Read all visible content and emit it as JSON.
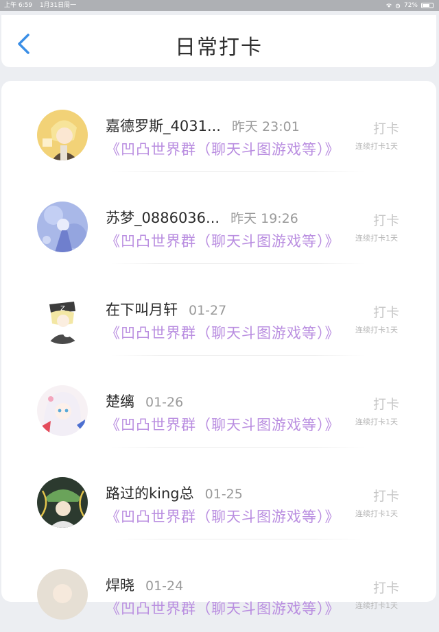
{
  "status_bar": {
    "time": "上午 6:59",
    "date": "1月31日周一",
    "battery": "72%",
    "battery_level": 0.72
  },
  "header": {
    "title": "日常打卡",
    "back_icon": "chevron-left-icon",
    "accent_color": "#3a8ee6"
  },
  "colors": {
    "group_text": "#b98de0",
    "checkin_text": "#c6c6c6"
  },
  "entries": [
    {
      "name": "嘉德罗斯_4031...",
      "time": "昨天 23:01",
      "group": "《凹凸世界群（聊天斗图游戏等）》",
      "action": "打卡",
      "streak": "连续打卡1天"
    },
    {
      "name": "苏梦_0886036...",
      "time": "昨天 19:26",
      "group": "《凹凸世界群（聊天斗图游戏等）》",
      "action": "打卡",
      "streak": "连续打卡1天"
    },
    {
      "name": "在下叫月轩",
      "time": "01-27",
      "group": "《凹凸世界群（聊天斗图游戏等）》",
      "action": "打卡",
      "streak": "连续打卡1天"
    },
    {
      "name": "楚缡",
      "time": "01-26",
      "group": "《凹凸世界群（聊天斗图游戏等）》",
      "action": "打卡",
      "streak": "连续打卡1天"
    },
    {
      "name": "路过的king总",
      "time": "01-25",
      "group": "《凹凸世界群（聊天斗图游戏等）》",
      "action": "打卡",
      "streak": "连续打卡1天"
    },
    {
      "name": "焊晓",
      "time": "01-24",
      "group": "《凹凸世界群（聊天斗图游戏等）》",
      "action": "打卡",
      "streak": "连续打卡1天"
    }
  ]
}
